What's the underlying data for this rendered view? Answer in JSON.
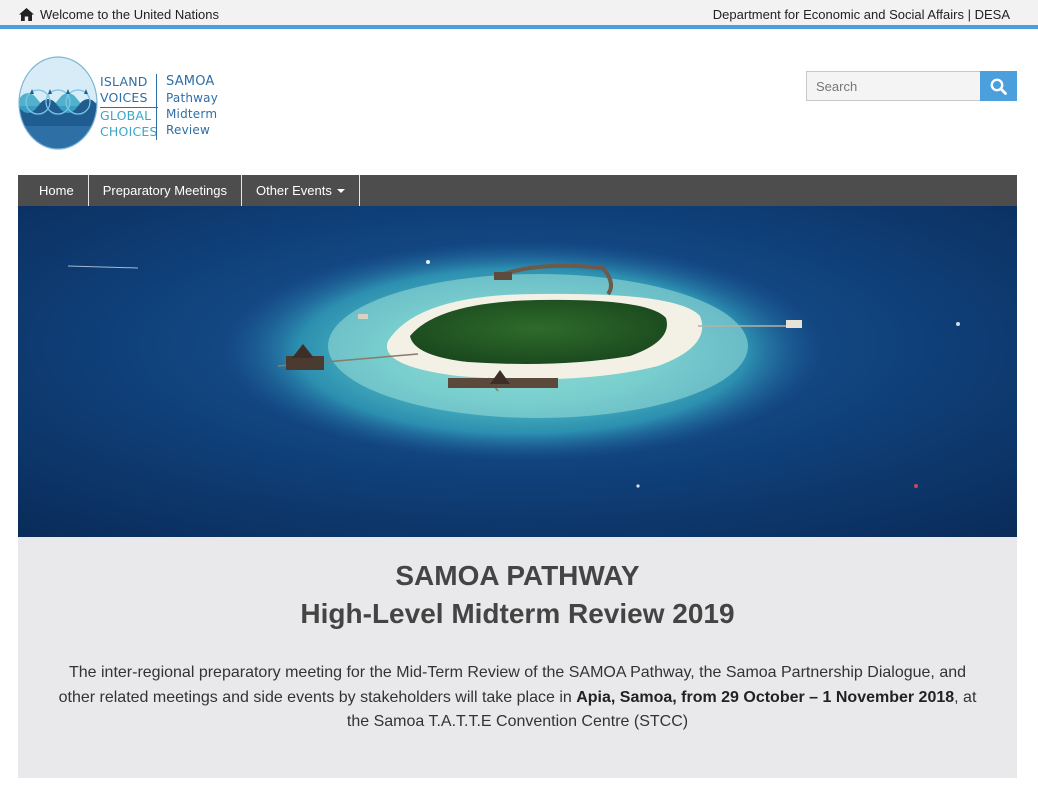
{
  "topbar": {
    "welcome": "Welcome to the United Nations",
    "department": "Department for Economic and Social Affairs | DESA"
  },
  "logo": {
    "line1": "ISLAND",
    "line2": "VOICES",
    "line3": "GLOBAL",
    "line4": "CHOICES",
    "sub1": "SAMOA",
    "sub2": "Pathway",
    "sub3": "Midterm",
    "sub4": "Review"
  },
  "search": {
    "placeholder": "Search",
    "icon": "search-icon"
  },
  "nav": {
    "items": [
      {
        "label": "Home"
      },
      {
        "label": "Preparatory Meetings"
      },
      {
        "label": "Other Events"
      }
    ]
  },
  "hero": {
    "description": "aerial view of atoll island resort"
  },
  "main": {
    "title_line1": "SAMOA PATHWAY",
    "title_line2": "High-Level Midterm Review 2019",
    "para_part1": "The inter-regional preparatory meeting for the Mid-Term Review of the SAMOA Pathway, the Samoa Partnership Dialogue, and other related meetings and side events by stakeholders will take place in ",
    "para_bold": "Apia, Samoa, from 29 October – 1 November 2018",
    "para_part2": ", at the Samoa T.A.T.T.E Convention Centre (STCC)"
  },
  "colors": {
    "accent": "#4a9fdc",
    "nav_bg": "#4d4d4d",
    "content_bg": "#e9e9eb",
    "logo_blue": "#2e6fa6",
    "logo_teal": "#3aa7c6"
  }
}
